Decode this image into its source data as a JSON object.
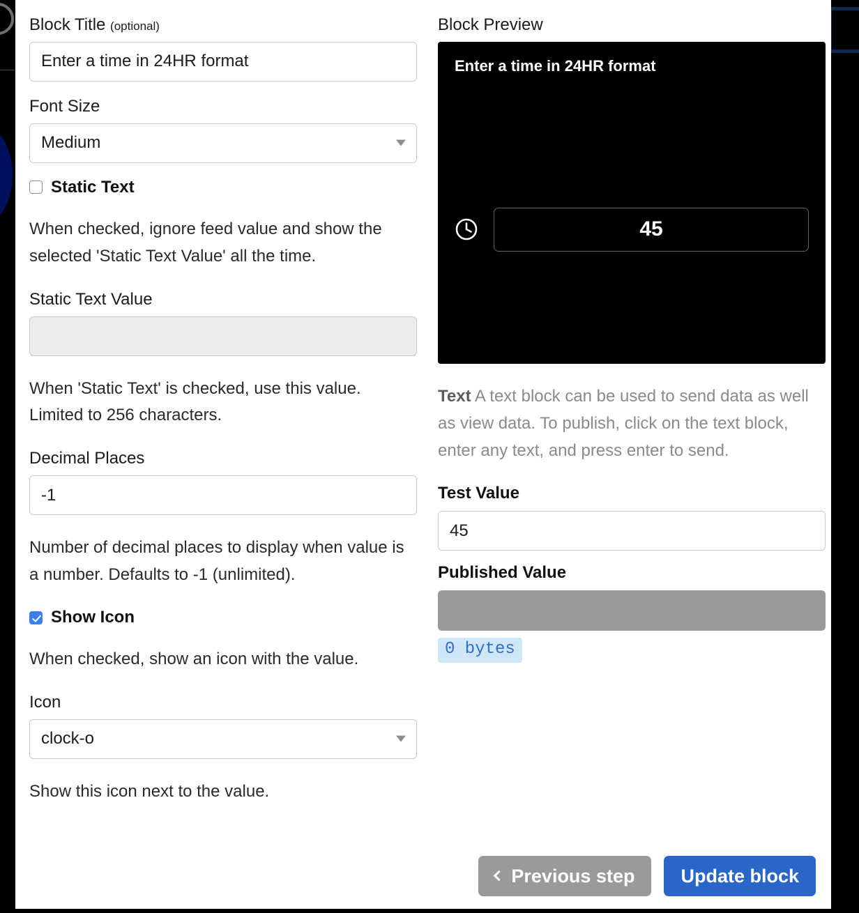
{
  "left_column": {
    "block_title": {
      "label": "Block Title",
      "optional_suffix": "(optional)",
      "value": "Enter a time in 24HR format"
    },
    "font_size": {
      "label": "Font Size",
      "selected": "Medium"
    },
    "static_text": {
      "checkbox_label": "Static Text",
      "checked": false,
      "help": "When checked, ignore feed value and show the selected 'Static Text Value' all the time."
    },
    "static_text_value": {
      "label": "Static Text Value",
      "value": "",
      "disabled": true,
      "help": "When 'Static Text' is checked, use this value. Limited to 256 characters."
    },
    "decimal_places": {
      "label": "Decimal Places",
      "value": "-1",
      "help": "Number of decimal places to display when value is a number. Defaults to -1 (unlimited)."
    },
    "show_icon": {
      "checkbox_label": "Show Icon",
      "checked": true,
      "help": "When checked, show an icon with the value."
    },
    "icon": {
      "label": "Icon",
      "selected": "clock-o",
      "help": "Show this icon next to the value."
    }
  },
  "right_column": {
    "preview": {
      "label": "Block Preview",
      "title": "Enter a time in 24HR format",
      "icon_name": "clock-o",
      "value": "45",
      "background_color": "#000000"
    },
    "description": {
      "strong": "Text",
      "body": " A text block can be used to send data as well as view data. To publish, click on the text block, enter any text, and press enter to send."
    },
    "test_value": {
      "label": "Test Value",
      "value": "45"
    },
    "published_value": {
      "label": "Published Value",
      "value": "",
      "bytes_badge": "0 bytes"
    }
  },
  "footer": {
    "previous_label": "Previous step",
    "update_label": "Update block"
  },
  "colors": {
    "accent_blue": "#2a66c8",
    "checkbox_blue": "#3b7ef3",
    "grey_button": "#9a9a9a",
    "badge_bg": "#cfe6f7",
    "badge_text": "#2f6fd0"
  }
}
